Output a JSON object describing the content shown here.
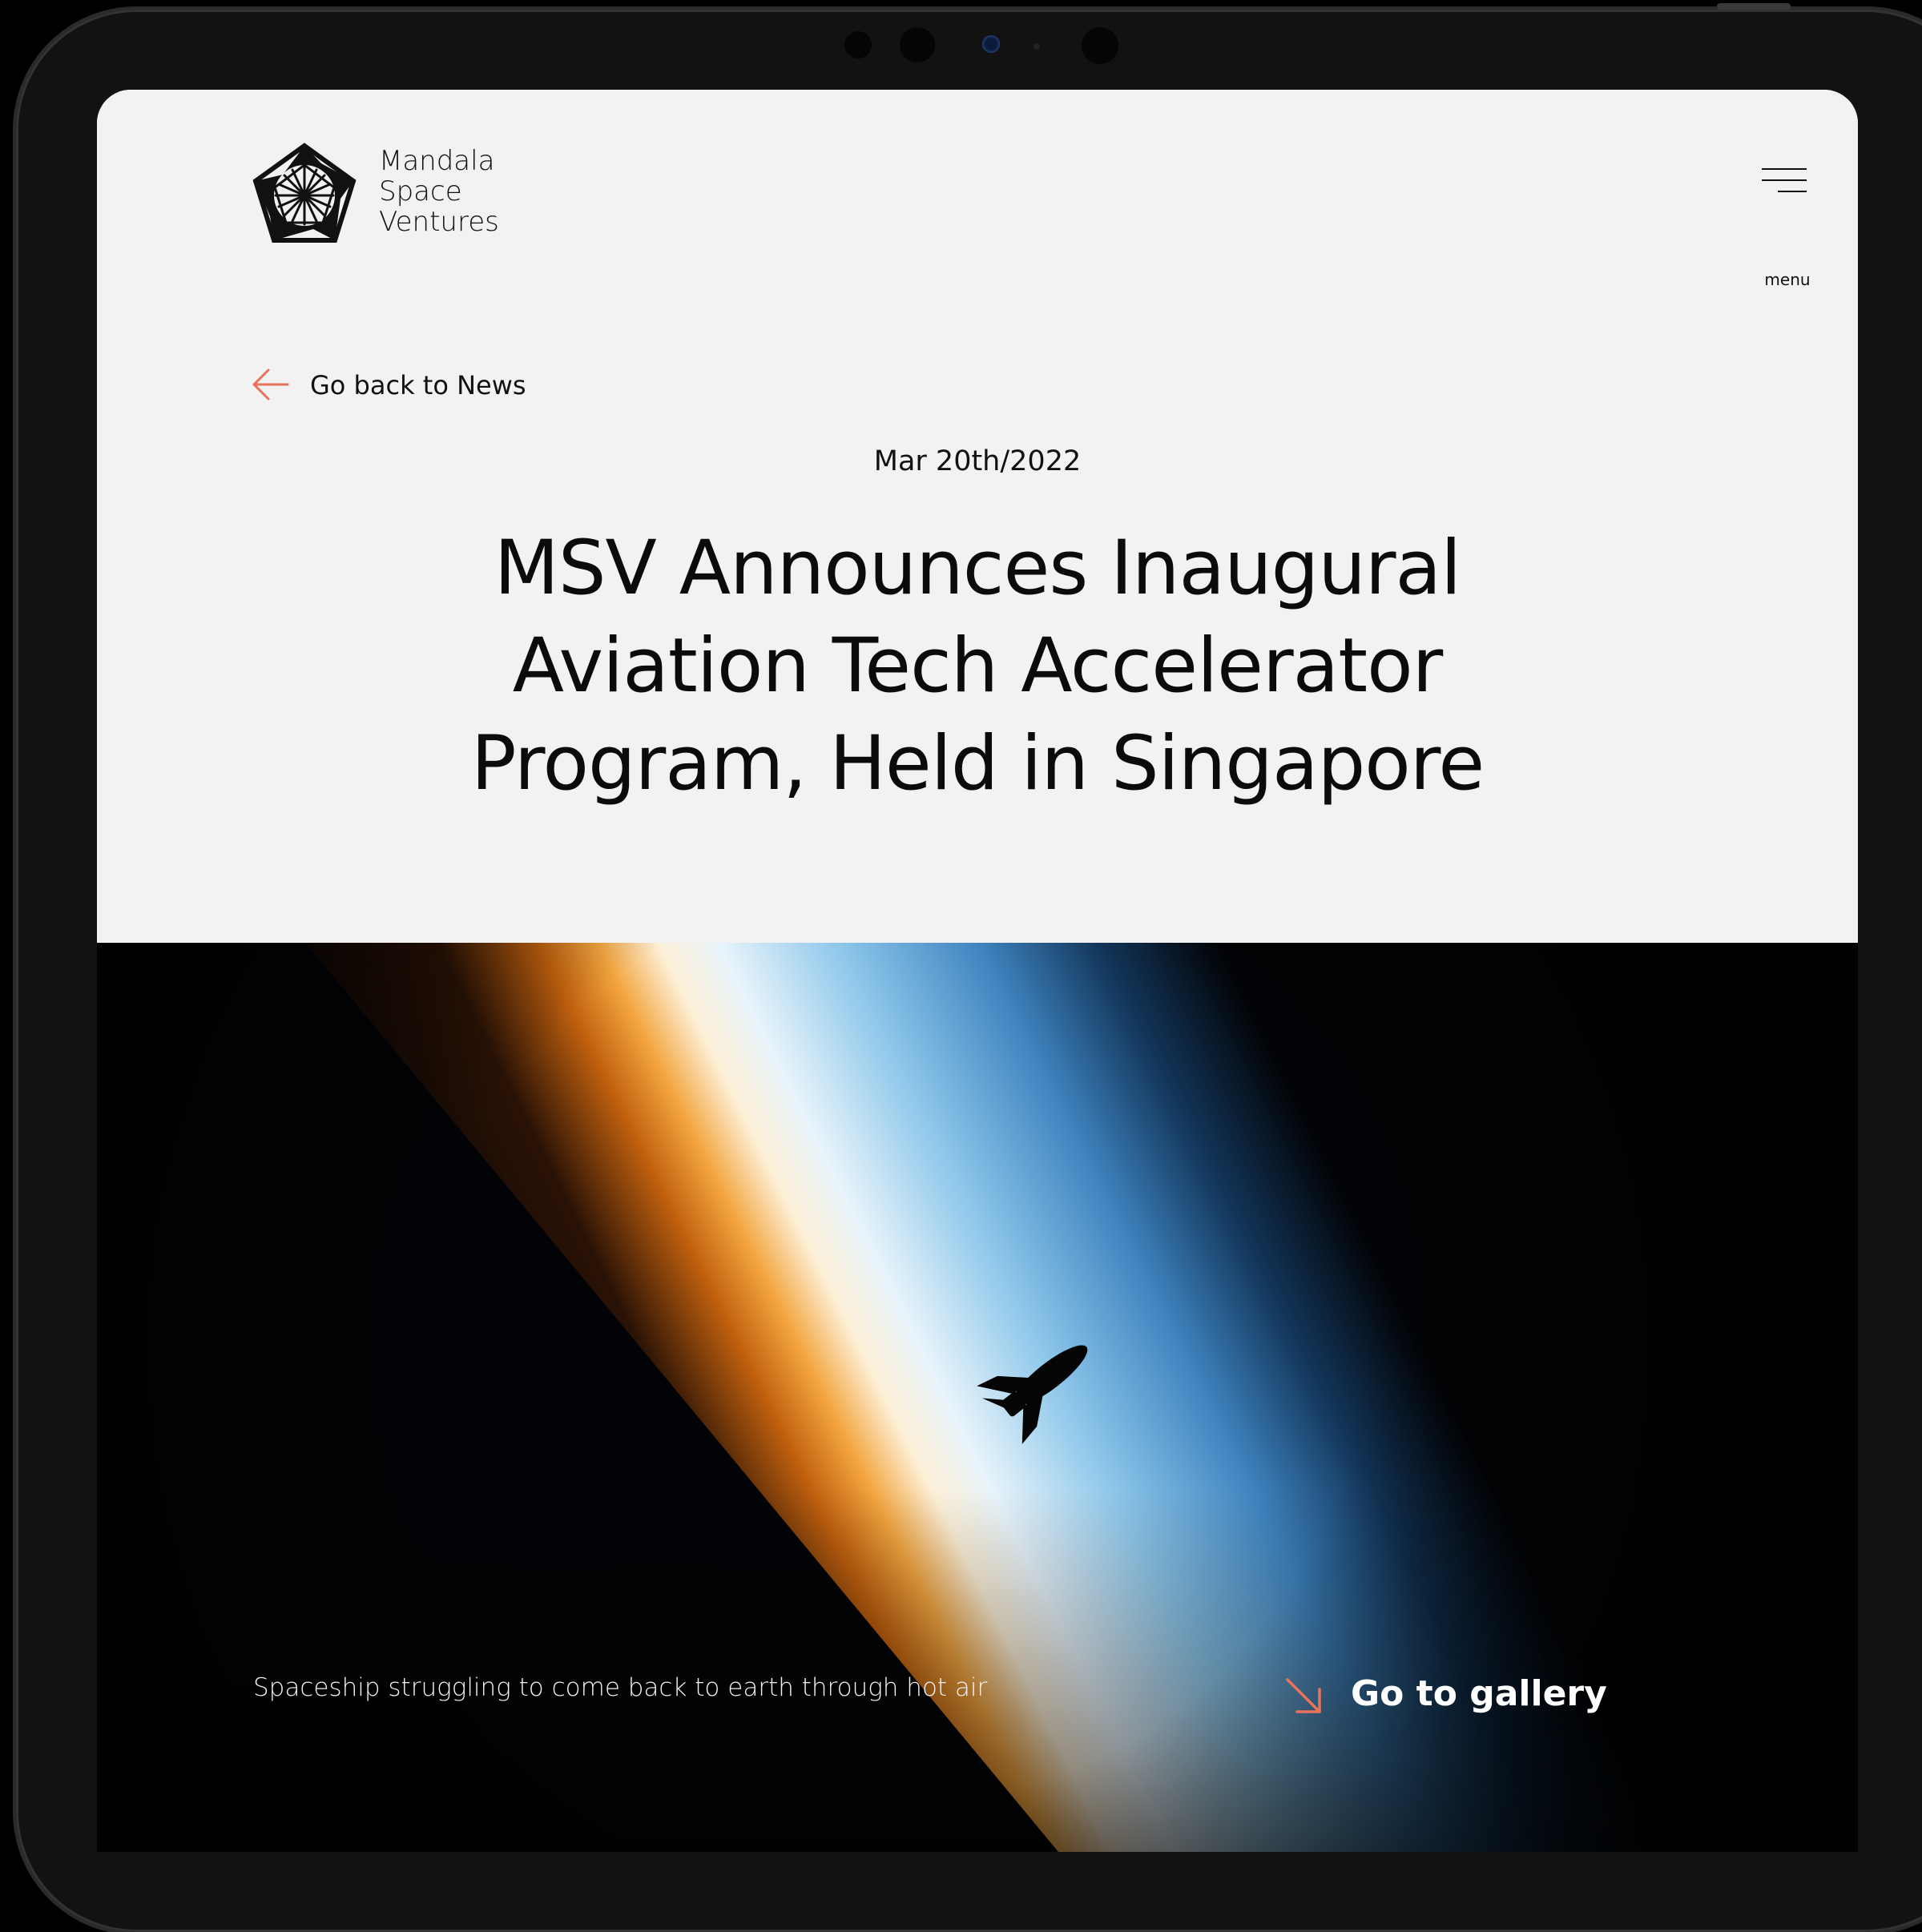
{
  "brand": {
    "name_lines": [
      "Mandala",
      "Space",
      "Ventures"
    ],
    "logo_icon": "pentagon-star-logo-icon"
  },
  "menu": {
    "label": "menu",
    "icon": "hamburger-icon"
  },
  "back_link": {
    "label": "Go back to News",
    "icon": "arrow-left-icon"
  },
  "article": {
    "date": "Mar 20th/2022",
    "title_lines": [
      "MSV Announces Inaugural",
      "Aviation Tech Accelerator",
      "Program, Held in Singapore"
    ]
  },
  "hero": {
    "caption": "Spaceship struggling to come back to earth through hot air",
    "gallery_label": "Go to gallery",
    "gallery_icon": "arrow-down-right-icon"
  },
  "colors": {
    "accent": "#e8735a",
    "page_bg": "#f2f2f2",
    "text": "#111111",
    "frame": "#121212"
  }
}
